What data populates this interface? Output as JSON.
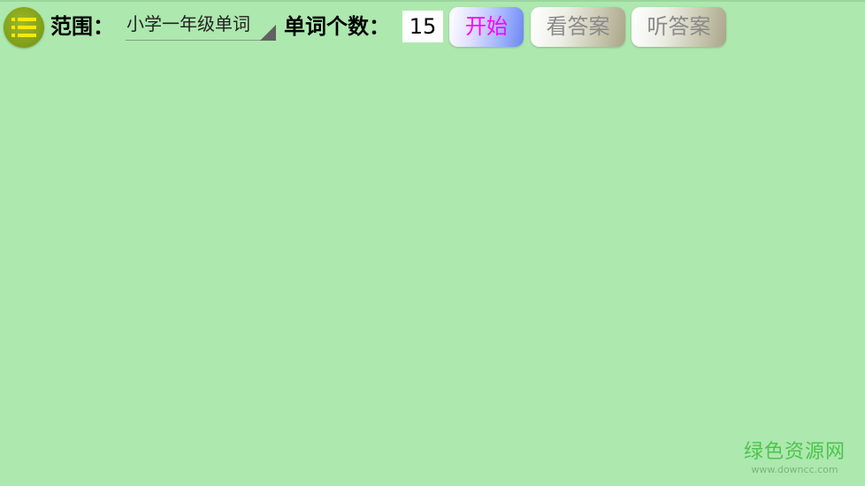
{
  "toolbar": {
    "menu_icon": "menu-list-icon",
    "range_label": "范围：",
    "range_value": "小学一年级单词",
    "count_label": "单词个数：",
    "count_value": "15",
    "start_label": "开始",
    "show_answer_label": "看答案",
    "listen_answer_label": "听答案"
  },
  "watermark": {
    "title": "绿色资源网",
    "url": "www.downcc.com"
  },
  "colors": {
    "background": "#ade8ae",
    "menu_button": "#8aa81e",
    "menu_lines": "#ffe800",
    "start_text": "#ff00ff",
    "disabled_text": "#8a8a8a",
    "watermark": "#4ec44e"
  }
}
